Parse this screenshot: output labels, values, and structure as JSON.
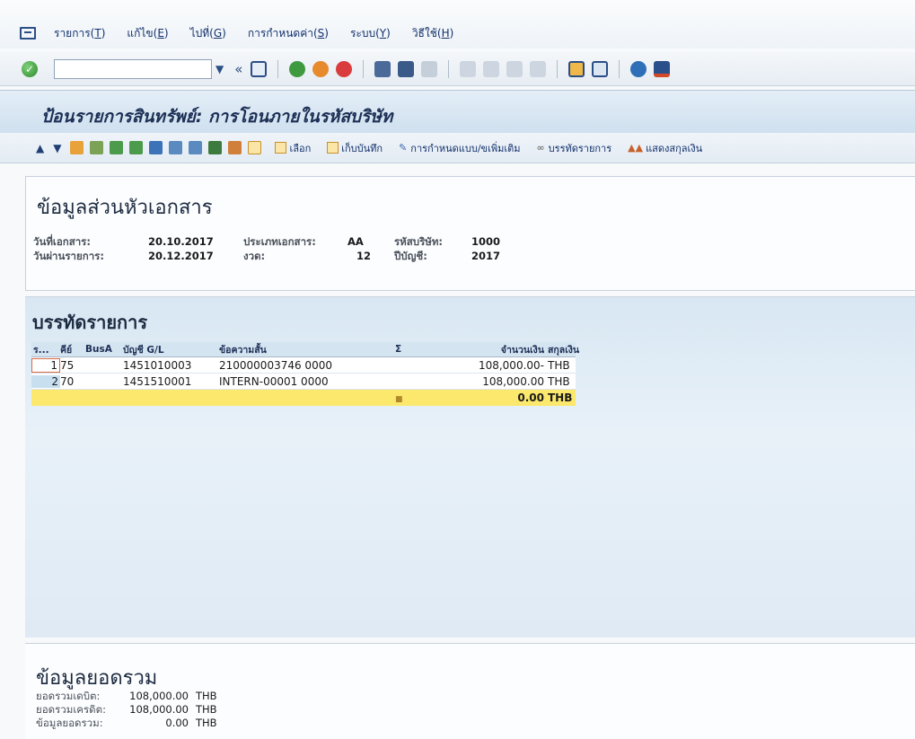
{
  "menu": {
    "items": [
      {
        "label": "รายการ(",
        "accel": "T",
        "close": ")"
      },
      {
        "label": "แก้ไข(",
        "accel": "E",
        "close": ")"
      },
      {
        "label": "ไปที่(",
        "accel": "G",
        "close": ")"
      },
      {
        "label": "การกำหนดค่า(",
        "accel": "S",
        "close": ")"
      },
      {
        "label": "ระบบ(",
        "accel": "Y",
        "close": ")"
      },
      {
        "label": "วิธีใช้(",
        "accel": "H",
        "close": ")"
      }
    ]
  },
  "toolbar": {
    "command_value": "",
    "back_glyph": "«"
  },
  "title": "ป้อนรายการสินทรัพย์: การโอนภายในรหัสบริษัท",
  "app_toolbar": {
    "select_label": "เลือก",
    "save_label": "เก็บบันทึก",
    "defaults_label": "การกำหนดแบบ/ขเพิ่มเติม",
    "line_items_label": "บรรทัดรายการ",
    "currency_label": "แสดงสกุลเงิน"
  },
  "header": {
    "heading": "ข้อมูลส่วนหัวเอกสาร",
    "doc_date_label": "วันที่เอกสาร:",
    "doc_date": "20.10.2017",
    "posting_date_label": "วันผ่านรายการ:",
    "posting_date": "20.12.2017",
    "doc_type_label": "ประเภทเอกสาร:",
    "doc_type": "AA",
    "period_label": "งวด:",
    "period": "12",
    "company_code_label": "รหัสบริษัท:",
    "company_code": "1000",
    "fiscal_year_label": "ปีบัญชี:",
    "fiscal_year": "2017"
  },
  "items": {
    "heading": "บรรทัดรายการ",
    "columns": [
      "ร...",
      "คีย์",
      "BusA",
      "บัญชี G/L",
      "ข้อความสั้น",
      "Σ",
      "จำนวนเงิน",
      "สกุลเงิน"
    ],
    "rows": [
      {
        "no": "1",
        "key": "75",
        "busa": "",
        "gl": "1451010003",
        "text": "210000003746 0000",
        "amount": "108,000.00-",
        "currency": "THB"
      },
      {
        "no": "2",
        "key": "70",
        "busa": "",
        "gl": "1451510001",
        "text": "INTERN-00001 0000",
        "amount": "108,000.00",
        "currency": "THB"
      }
    ],
    "total": {
      "amount": "0.00",
      "currency": "THB"
    }
  },
  "totals": {
    "heading": "ข้อมูลยอดรวม",
    "debit_label": "ยอดรวมเดบิต:",
    "debit": "108,000.00",
    "debit_cur": "THB",
    "credit_label": "ยอดรวมเครดิต:",
    "credit": "108,000.00",
    "credit_cur": "THB",
    "balance_label": "ข้อมูลยอดรวม:",
    "balance": "0.00",
    "balance_cur": "THB"
  }
}
